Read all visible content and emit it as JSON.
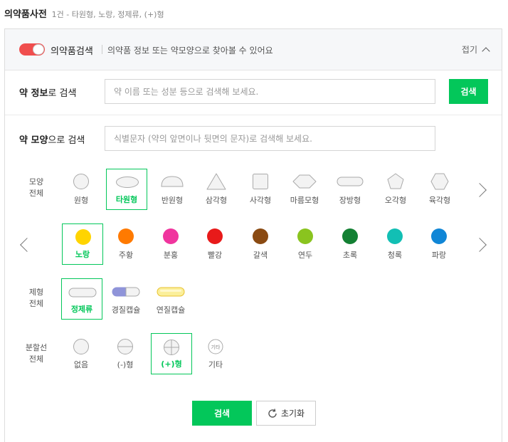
{
  "header": {
    "title": "의약품사전",
    "subtitle": "1건 - 타원형, 노랑, 정제류, (+)형"
  },
  "panel": {
    "name": "의약품검색",
    "description": "의약품 정보 또는 약모양으로 찾아볼 수 있어요",
    "collapse_label": "접기",
    "toggle_color": "#f04e4e"
  },
  "info_search": {
    "label_bold": "약 정보",
    "label_rest": "로 검색",
    "placeholder": "약 이름 또는 성분 등으로 검색해 보세요.",
    "button": "검색"
  },
  "shape_search": {
    "label_bold": "약 모양",
    "label_rest": "으로 검색",
    "placeholder": "식별문자 (약의 앞면이나 뒷면의 문자)로 검색해 보세요."
  },
  "shape": {
    "category_line1": "모양",
    "category_line2": "전체",
    "options": [
      {
        "label": "원형",
        "icon": "circle-icon",
        "selected": false
      },
      {
        "label": "타원형",
        "icon": "ellipse-icon",
        "selected": true
      },
      {
        "label": "반원형",
        "icon": "semicircle-icon",
        "selected": false
      },
      {
        "label": "삼각형",
        "icon": "triangle-icon",
        "selected": false
      },
      {
        "label": "사각형",
        "icon": "square-icon",
        "selected": false
      },
      {
        "label": "마름모형",
        "icon": "diamond-icon",
        "selected": false
      },
      {
        "label": "장방형",
        "icon": "rectangle-icon",
        "selected": false
      },
      {
        "label": "오각형",
        "icon": "pentagon-icon",
        "selected": false
      },
      {
        "label": "육각형",
        "icon": "hexagon-icon",
        "selected": false
      }
    ]
  },
  "color": {
    "options": [
      {
        "label": "노랑",
        "color": "#ffd400",
        "selected": true
      },
      {
        "label": "주황",
        "color": "#ff7a00",
        "selected": false
      },
      {
        "label": "분홍",
        "color": "#f0359e",
        "selected": false
      },
      {
        "label": "빨강",
        "color": "#e81a1a",
        "selected": false
      },
      {
        "label": "갈색",
        "color": "#8a4a12",
        "selected": false
      },
      {
        "label": "연두",
        "color": "#8ac41f",
        "selected": false
      },
      {
        "label": "초록",
        "color": "#138033",
        "selected": false
      },
      {
        "label": "청록",
        "color": "#12bfb4",
        "selected": false
      },
      {
        "label": "파랑",
        "color": "#1086d6",
        "selected": false
      }
    ]
  },
  "formulation": {
    "category_line1": "제형",
    "category_line2": "전체",
    "options": [
      {
        "label": "정제류",
        "icon": "tablet-icon",
        "selected": true
      },
      {
        "label": "경질캡슐",
        "icon": "hard-capsule-icon",
        "selected": false
      },
      {
        "label": "연질캡슐",
        "icon": "soft-capsule-icon",
        "selected": false
      }
    ]
  },
  "scoreline": {
    "category_line1": "분할선",
    "category_line2": "전체",
    "options": [
      {
        "label": "없음",
        "icon": "no-line-icon",
        "selected": false
      },
      {
        "label": "(-)형",
        "icon": "minus-line-icon",
        "selected": false
      },
      {
        "label": "(+)형",
        "icon": "plus-line-icon",
        "selected": true
      },
      {
        "label": "기타",
        "icon": "other-line-icon",
        "selected": false,
        "icon_text": "기타"
      }
    ]
  },
  "actions": {
    "search_label": "검색",
    "reset_label": "초기화"
  },
  "colors": {
    "accent": "#03c75a",
    "border": "#dddddd"
  }
}
